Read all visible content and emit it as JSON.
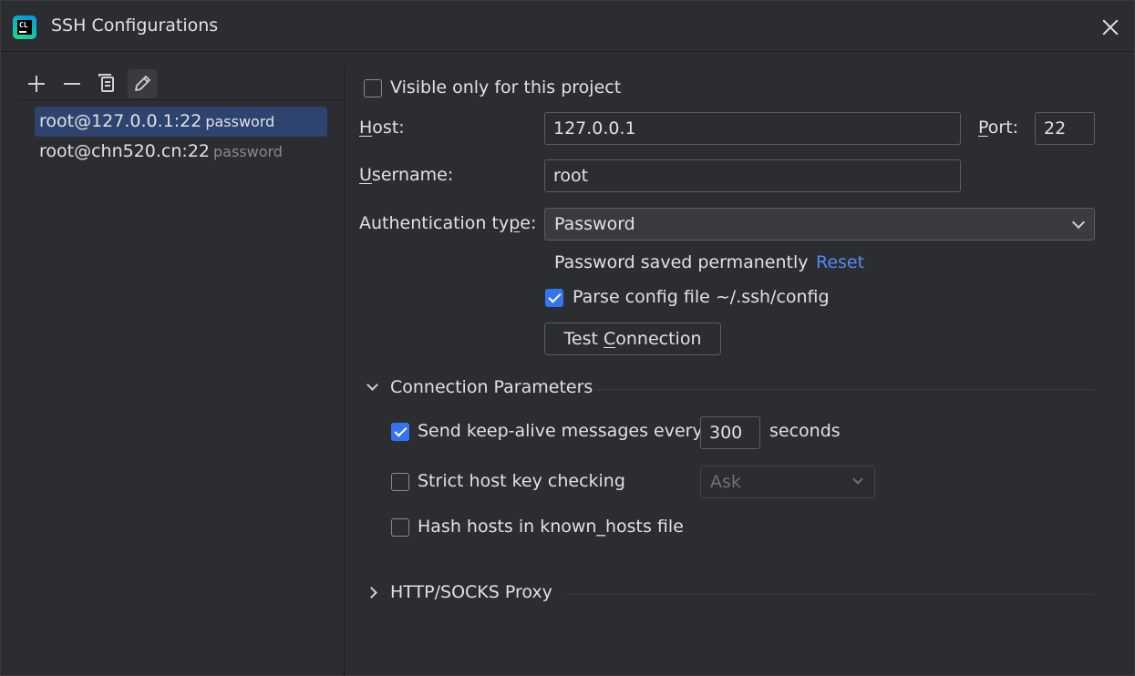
{
  "window": {
    "title": "SSH Configurations",
    "app_icon_text": "CL"
  },
  "toolbar": {
    "add_icon": "plus-icon",
    "remove_icon": "minus-icon",
    "copy_icon": "copy-icon",
    "edit_icon": "pencil-icon"
  },
  "configs": [
    {
      "name": "root@127.0.0.1:22",
      "auth": "password",
      "selected": true
    },
    {
      "name": "root@chn520.cn:22",
      "auth": "password",
      "selected": false
    }
  ],
  "form": {
    "visible_only_label": "Visible only for this project",
    "visible_only_checked": false,
    "host_label_u": "H",
    "host_label_rest": "ost:",
    "host_value": "127.0.0.1",
    "port_label_u": "P",
    "port_label_rest": "ort:",
    "port_value": "22",
    "username_label_u": "U",
    "username_label_rest": "sername:",
    "username_value": "root",
    "auth_label_pre": "Authentication ty",
    "auth_label_u": "p",
    "auth_label_post": "e:",
    "auth_value": "Password",
    "password_status": "Password saved permanently",
    "reset_link": "Reset",
    "parse_config_label": "Parse config file ~/.ssh/config",
    "parse_config_checked": true,
    "test_btn_pre": "Test ",
    "test_btn_u": "C",
    "test_btn_post": "onnection"
  },
  "connection_params": {
    "title": "Connection Parameters",
    "keepalive_pre": "Send keep-alive messages every",
    "keepalive_value": "300",
    "keepalive_post": "seconds",
    "keepalive_checked": true,
    "strict_label": "Strict host key checking",
    "strict_checked": false,
    "strict_select": "Ask",
    "hash_label": "Hash hosts in known_hosts file",
    "hash_checked": false
  },
  "proxy": {
    "title": "HTTP/SOCKS Proxy"
  }
}
